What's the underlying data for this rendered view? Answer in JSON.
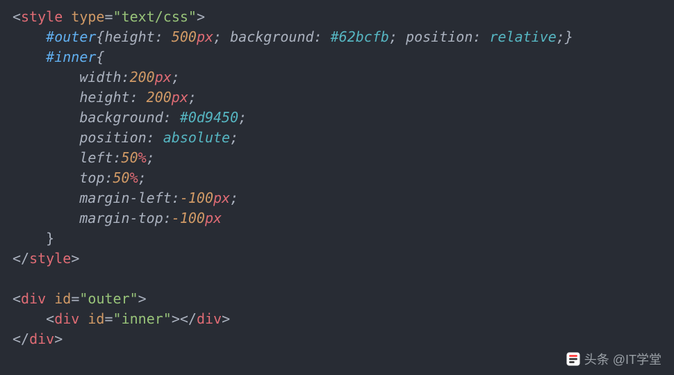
{
  "code": {
    "lines": [
      {
        "text": "<style type=\"text/css\">"
      },
      {
        "text": "    #outer{height: 500px; background: #62bcfb; position: relative;}"
      },
      {
        "text": "    #inner{"
      },
      {
        "text": "        width:200px;"
      },
      {
        "text": "        height: 200px;"
      },
      {
        "text": "        background: #0d9450;"
      },
      {
        "text": "        position: absolute;"
      },
      {
        "text": "        left:50%;"
      },
      {
        "text": "        top:50%;"
      },
      {
        "text": "        margin-left:-100px;"
      },
      {
        "text": "        margin-top:-100px"
      },
      {
        "text": "    }"
      },
      {
        "text": "</style>"
      },
      {
        "text": ""
      },
      {
        "text": "<div id=\"outer\">"
      },
      {
        "text": "    <div id=\"inner\"></div>"
      },
      {
        "text": "</div>"
      }
    ],
    "t": {
      "style_open_1": "<",
      "style_open_2": "style",
      "style_open_3": " ",
      "style_open_4": "type",
      "style_open_5": "=",
      "style_open_6": "\"text/css\"",
      "style_open_7": ">",
      "outer_sel": "#outer",
      "brace_l": "{",
      "brace_r": "}",
      "outer_h_prop": "height",
      "colon": ":",
      "sp": " ",
      "outer_h_num": "500",
      "px": "px",
      "semi": ";",
      "outer_bg_prop": "background",
      "outer_bg_val": "#62bcfb",
      "outer_pos_prop": "position",
      "outer_pos_val": "relative",
      "inner_sel": "#inner",
      "inner_w_prop": "width",
      "inner_w_num": "200",
      "inner_h_prop": "height",
      "inner_h_num": "200",
      "inner_bg_prop": "background",
      "inner_bg_val": "#0d9450",
      "inner_pos_prop": "position",
      "inner_pos_val": "absolute",
      "inner_left_prop": "left",
      "inner_left_num": "50",
      "pct": "%",
      "inner_top_prop": "top",
      "inner_top_num": "50",
      "inner_ml_prop": "margin-left",
      "inner_ml_num": "-100",
      "inner_mt_prop": "margin-top",
      "inner_mt_num": "-100",
      "style_close_1": "</",
      "style_close_2": "style",
      "style_close_3": ">",
      "div_open_lt": "<",
      "div": "div",
      "id_attr": "id",
      "eq": "=",
      "outer_str": "\"outer\"",
      "inner_str": "\"inner\"",
      "gt": ">",
      "div_close_lt": "</",
      "indent1": "    ",
      "indent2": "        "
    }
  },
  "watermark": {
    "text": "头条 @IT学堂"
  },
  "colors": {
    "background": "#282c34",
    "default": "#abb2bf",
    "tag": "#e06c75",
    "attr_num": "#d19a66",
    "string": "#98c379",
    "selector": "#61afef",
    "value_keyword": "#56b6c2"
  }
}
